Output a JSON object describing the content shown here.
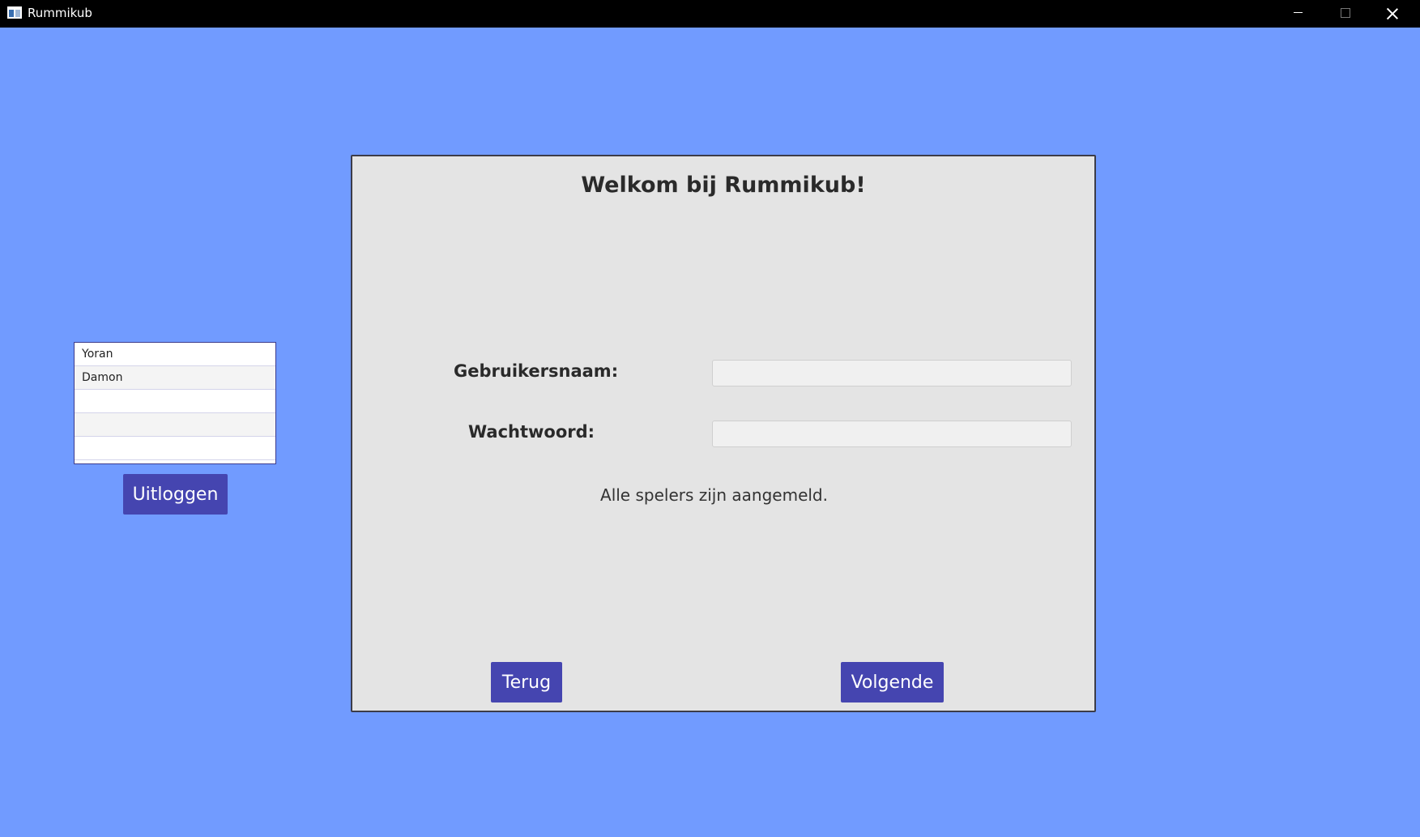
{
  "window": {
    "title": "Rummikub"
  },
  "players": [
    "Yoran",
    "Damon",
    "",
    "",
    ""
  ],
  "sidebar": {
    "logout_label": "Uitloggen"
  },
  "login": {
    "heading": "Welkom bij Rummikub!",
    "username_label": "Gebruikersnaam:",
    "username_value": "",
    "password_label": "Wachtwoord:",
    "password_value": "",
    "status_text": "Alle spelers zijn aangemeld.",
    "back_label": "Terug",
    "next_label": "Volgende"
  },
  "icons": {
    "app": "app-window-icon",
    "minimize": "minimize-icon",
    "maximize": "maximize-icon",
    "close": "close-icon"
  },
  "colors": {
    "background": "#719bff",
    "panel": "#e4e4e4",
    "button": "#4545b0",
    "titlebar": "#000000"
  }
}
